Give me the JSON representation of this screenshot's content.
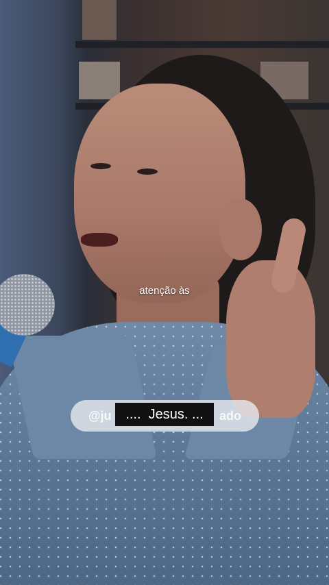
{
  "video": {
    "caption_line": "atenção às",
    "subtitle": "....  Jesus. ...",
    "watermark_left": "@ju",
    "watermark_right": "ado"
  },
  "colors": {
    "subtitle_bg": "#111111",
    "pill_bg": "#e6e8ec",
    "text": "#ffffff"
  }
}
